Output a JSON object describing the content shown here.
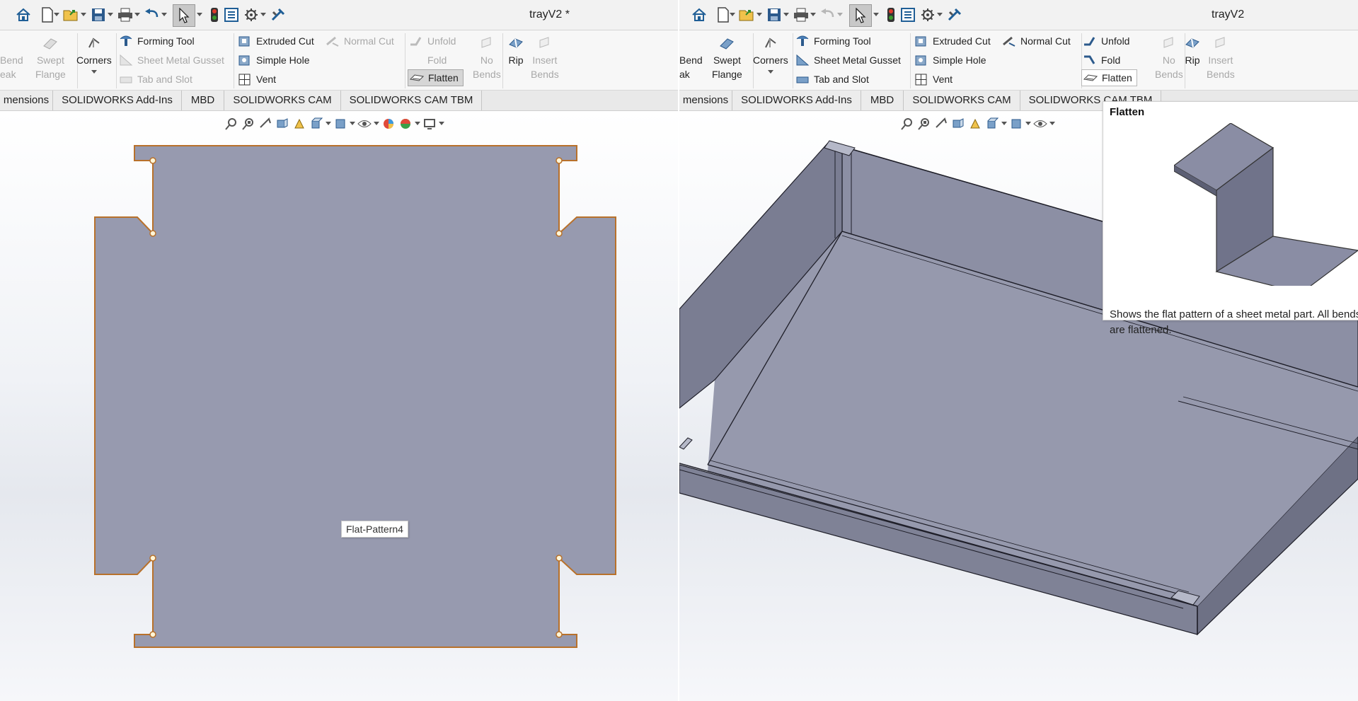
{
  "left": {
    "title": "trayV2 *",
    "ribbon": {
      "bend": [
        "Bend",
        "eak"
      ],
      "swept_flange": [
        "Swept",
        "Flange"
      ],
      "corners": "Corners",
      "forming_tool": "Forming Tool",
      "sheet_metal_gusset": "Sheet Metal Gusset",
      "tab_and_slot": "Tab and Slot",
      "extruded_cut": "Extruded Cut",
      "simple_hole": "Simple Hole",
      "vent": "Vent",
      "normal_cut": "Normal Cut",
      "unfold": "Unfold",
      "fold": "Fold",
      "flatten": "Flatten",
      "no_bends": [
        "No",
        "Bends"
      ],
      "rip": "Rip",
      "insert_bends": [
        "Insert",
        "Bends"
      ]
    },
    "tabs": [
      "mensions",
      "SOLIDWORKS Add-Ins",
      "MBD",
      "SOLIDWORKS CAM",
      "SOLIDWORKS CAM TBM"
    ],
    "label": "Flat-Pattern4"
  },
  "right": {
    "title": "trayV2",
    "ribbon": {
      "bend": [
        "Bend",
        "ak"
      ],
      "swept_flange": [
        "Swept",
        "Flange"
      ],
      "corners": "Corners",
      "forming_tool": "Forming Tool",
      "sheet_metal_gusset": "Sheet Metal Gusset",
      "tab_and_slot": "Tab and Slot",
      "extruded_cut": "Extruded Cut",
      "simple_hole": "Simple Hole",
      "vent": "Vent",
      "normal_cut": "Normal Cut",
      "unfold": "Unfold",
      "fold": "Fold",
      "flatten": "Flatten",
      "no_bends": [
        "No",
        "Bends"
      ],
      "rip": "Rip",
      "insert_bends": [
        "Insert",
        "Bends"
      ]
    },
    "tabs": [
      "mensions",
      "SOLIDWORKS Add-Ins",
      "MBD",
      "SOLIDWORKS CAM",
      "SOLIDWORKS CAM TBM"
    ],
    "tooltip": {
      "title": "Flatten",
      "description": "Shows the flat pattern of a sheet metal part. All bends are flattened."
    }
  },
  "colors": {
    "part_face": "#979aaf",
    "part_edge": "#b8712b",
    "ribbon_bg": "#f7f7f7"
  }
}
